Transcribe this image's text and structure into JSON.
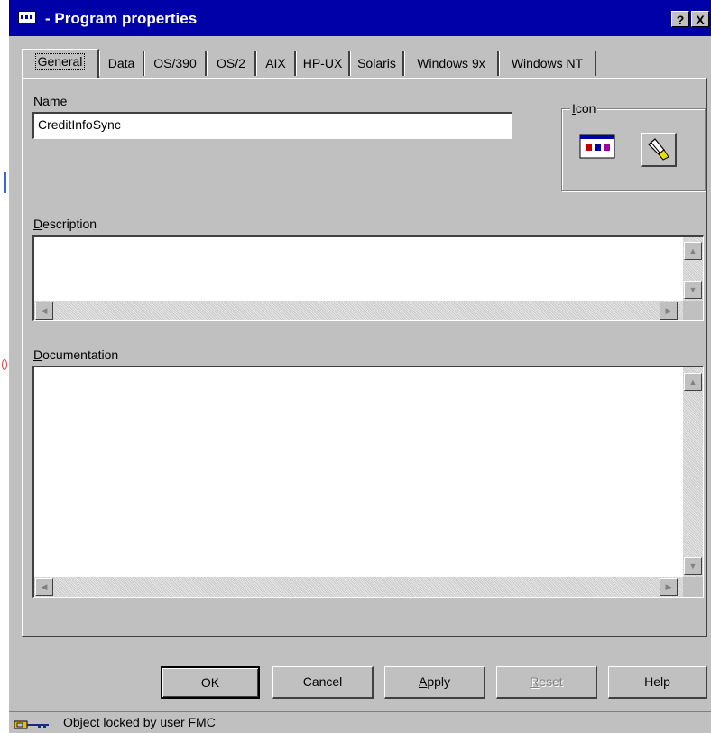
{
  "window": {
    "title": "- Program properties",
    "help_button": "?",
    "close_button": "X"
  },
  "tabs": [
    {
      "label": "General",
      "active": true
    },
    {
      "label": "Data"
    },
    {
      "label": "OS/390"
    },
    {
      "label": "OS/2"
    },
    {
      "label": "AIX"
    },
    {
      "label": "HP-UX"
    },
    {
      "label": "Solaris"
    },
    {
      "label": "Windows 9x"
    },
    {
      "label": "Windows NT"
    }
  ],
  "general": {
    "name_label_first": "N",
    "name_label_rest": "ame",
    "name_value": "CreditInfoSync",
    "icon_label_first": "I",
    "icon_label_rest": "con",
    "description_label_first": "D",
    "description_label_rest": "escription",
    "description_value": "",
    "documentation_label_first": "D",
    "documentation_label_mid": "o",
    "documentation_label_rest": "cumentation",
    "documentation_value": ""
  },
  "buttons": {
    "ok": "OK",
    "cancel": "Cancel",
    "apply_first": "A",
    "apply_rest": "pply",
    "reset_first": "R",
    "reset_rest": "eset",
    "help": "Help"
  },
  "statusbar": {
    "text": "Object locked by user FMC",
    "icon": "key-icon"
  },
  "colors": {
    "titlebar": "#0000a8",
    "face": "#c0c0c0"
  }
}
